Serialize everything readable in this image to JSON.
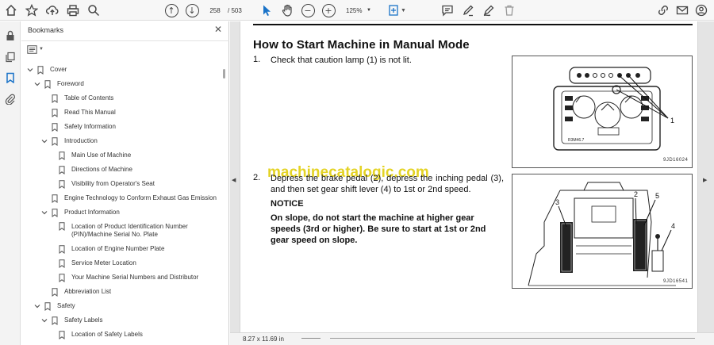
{
  "toolbar": {
    "icons": [
      "home-icon",
      "star-icon",
      "cloud-upload-icon",
      "print-icon",
      "zoom-search-icon",
      "page-up-icon",
      "page-down-icon",
      "select-cursor-icon",
      "hand-tool-icon",
      "zoom-out-icon",
      "zoom-in-icon",
      "fit-page-icon",
      "comment-icon",
      "draw-icon",
      "delete-icon",
      "share-link-icon",
      "email-icon",
      "profile-icon"
    ],
    "page_current": "258",
    "page_total": "/ 503",
    "zoom": "125%"
  },
  "sidebar": {
    "icons": [
      "lock-icon",
      "copy-pages-icon",
      "bookmark-icon",
      "attachment-icon"
    ],
    "active": "bookmark-icon"
  },
  "bookmarks": {
    "title": "Bookmarks",
    "items": [
      {
        "label": "Cover",
        "level": 0,
        "expanded": true
      },
      {
        "label": "Foreword",
        "level": 1,
        "expanded": true
      },
      {
        "label": "Table of Contents",
        "level": 2,
        "expanded": null
      },
      {
        "label": "Read This Manual",
        "level": 2,
        "expanded": null
      },
      {
        "label": "Safety Information",
        "level": 2,
        "expanded": null
      },
      {
        "label": "Introduction",
        "level": 2,
        "expanded": true
      },
      {
        "label": "Main Use of Machine",
        "level": 3,
        "expanded": null
      },
      {
        "label": "Directions of Machine",
        "level": 3,
        "expanded": null
      },
      {
        "label": "Visibility from Operator's Seat",
        "level": 3,
        "expanded": null
      },
      {
        "label": "Engine Technology to Conform Exhaust Gas Emission",
        "level": 2,
        "expanded": null
      },
      {
        "label": "Product Information",
        "level": 2,
        "expanded": true
      },
      {
        "label": "Location of Product Identification Number (PIN)/Machine Serial No. Plate",
        "level": 3,
        "expanded": null
      },
      {
        "label": "Location of Engine Number Plate",
        "level": 3,
        "expanded": null
      },
      {
        "label": "Service Meter Location",
        "level": 3,
        "expanded": null
      },
      {
        "label": "Your Machine Serial Numbers and Distributor",
        "level": 3,
        "expanded": null
      },
      {
        "label": "Abbreviation List",
        "level": 2,
        "expanded": null
      },
      {
        "label": "Safety",
        "level": 1,
        "expanded": true
      },
      {
        "label": "Safety Labels",
        "level": 2,
        "expanded": true
      },
      {
        "label": "Location of Safety Labels",
        "level": 3,
        "expanded": null
      }
    ]
  },
  "document": {
    "heading": "How to Start Machine in Manual Mode",
    "step1_num": "1.",
    "step1_text": "Check that caution lamp (1) is not lit.",
    "step2_num": "2.",
    "step2_text": "Depress the brake pedal (2), depress the inching pedal (3), and then set gear shift lever (4) to 1st or 2nd speed.",
    "notice_title": "NOTICE",
    "notice_body": "On slope, do not start the machine at higher gear speeds (3rd or higher). Be sure to start at 1st or 2nd gear speed on slope.",
    "watermark": "machinecatalogic.com",
    "figure1_code": "9JD16024",
    "figure1_callout": "1",
    "figure2_code": "9JD16541",
    "figure2_callouts": [
      "3",
      "2",
      "5",
      "4"
    ],
    "panel_readout": "R3M46.7"
  },
  "status": {
    "page_size": "8.27 x 11.69 in"
  }
}
